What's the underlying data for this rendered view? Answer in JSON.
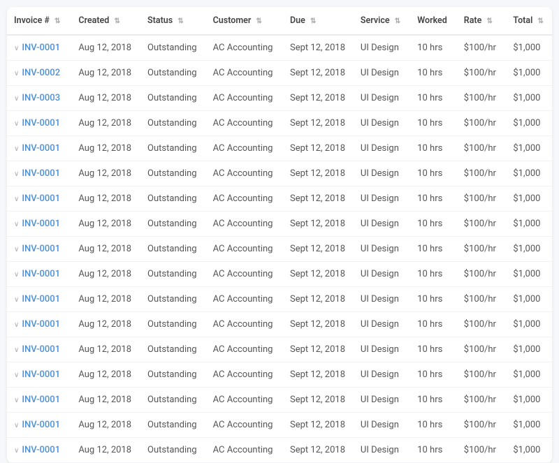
{
  "table": {
    "columns": [
      {
        "key": "invoice",
        "label": "Invoice #",
        "sortable": true
      },
      {
        "key": "created",
        "label": "Created",
        "sortable": true
      },
      {
        "key": "status",
        "label": "Status",
        "sortable": true
      },
      {
        "key": "customer",
        "label": "Customer",
        "sortable": true
      },
      {
        "key": "due",
        "label": "Due",
        "sortable": true
      },
      {
        "key": "service",
        "label": "Service",
        "sortable": true
      },
      {
        "key": "worked",
        "label": "Worked",
        "sortable": false
      },
      {
        "key": "rate",
        "label": "Rate",
        "sortable": true
      },
      {
        "key": "total",
        "label": "Total",
        "sortable": true
      }
    ],
    "rows": [
      {
        "invoice": "INV-0001",
        "created": "Aug 12, 2018",
        "status": "Outstanding",
        "customer": "AC Accounting",
        "due": "Sept 12, 2018",
        "service": "UI Design",
        "worked": "10 hrs",
        "rate": "$100/hr",
        "total": "$1,000"
      },
      {
        "invoice": "INV-0002",
        "created": "Aug 12, 2018",
        "status": "Outstanding",
        "customer": "AC Accounting",
        "due": "Sept 12, 2018",
        "service": "UI Design",
        "worked": "10 hrs",
        "rate": "$100/hr",
        "total": "$1,000"
      },
      {
        "invoice": "INV-0003",
        "created": "Aug 12, 2018",
        "status": "Outstanding",
        "customer": "AC Accounting",
        "due": "Sept 12, 2018",
        "service": "UI Design",
        "worked": "10 hrs",
        "rate": "$100/hr",
        "total": "$1,000"
      },
      {
        "invoice": "INV-0001",
        "created": "Aug 12, 2018",
        "status": "Outstanding",
        "customer": "AC Accounting",
        "due": "Sept 12, 2018",
        "service": "UI Design",
        "worked": "10 hrs",
        "rate": "$100/hr",
        "total": "$1,000"
      },
      {
        "invoice": "INV-0001",
        "created": "Aug 12, 2018",
        "status": "Outstanding",
        "customer": "AC Accounting",
        "due": "Sept 12, 2018",
        "service": "UI Design",
        "worked": "10 hrs",
        "rate": "$100/hr",
        "total": "$1,000"
      },
      {
        "invoice": "INV-0001",
        "created": "Aug 12, 2018",
        "status": "Outstanding",
        "customer": "AC Accounting",
        "due": "Sept 12, 2018",
        "service": "UI Design",
        "worked": "10 hrs",
        "rate": "$100/hr",
        "total": "$1,000"
      },
      {
        "invoice": "INV-0001",
        "created": "Aug 12, 2018",
        "status": "Outstanding",
        "customer": "AC Accounting",
        "due": "Sept 12, 2018",
        "service": "UI Design",
        "worked": "10 hrs",
        "rate": "$100/hr",
        "total": "$1,000"
      },
      {
        "invoice": "INV-0001",
        "created": "Aug 12, 2018",
        "status": "Outstanding",
        "customer": "AC Accounting",
        "due": "Sept 12, 2018",
        "service": "UI Design",
        "worked": "10 hrs",
        "rate": "$100/hr",
        "total": "$1,000"
      },
      {
        "invoice": "INV-0001",
        "created": "Aug 12, 2018",
        "status": "Outstanding",
        "customer": "AC Accounting",
        "due": "Sept 12, 2018",
        "service": "UI Design",
        "worked": "10 hrs",
        "rate": "$100/hr",
        "total": "$1,000"
      },
      {
        "invoice": "INV-0001",
        "created": "Aug 12, 2018",
        "status": "Outstanding",
        "customer": "AC Accounting",
        "due": "Sept 12, 2018",
        "service": "UI Design",
        "worked": "10 hrs",
        "rate": "$100/hr",
        "total": "$1,000"
      },
      {
        "invoice": "INV-0001",
        "created": "Aug 12, 2018",
        "status": "Outstanding",
        "customer": "AC Accounting",
        "due": "Sept 12, 2018",
        "service": "UI Design",
        "worked": "10 hrs",
        "rate": "$100/hr",
        "total": "$1,000"
      },
      {
        "invoice": "INV-0001",
        "created": "Aug 12, 2018",
        "status": "Outstanding",
        "customer": "AC Accounting",
        "due": "Sept 12, 2018",
        "service": "UI Design",
        "worked": "10 hrs",
        "rate": "$100/hr",
        "total": "$1,000"
      },
      {
        "invoice": "INV-0001",
        "created": "Aug 12, 2018",
        "status": "Outstanding",
        "customer": "AC Accounting",
        "due": "Sept 12, 2018",
        "service": "UI Design",
        "worked": "10 hrs",
        "rate": "$100/hr",
        "total": "$1,000"
      },
      {
        "invoice": "INV-0001",
        "created": "Aug 12, 2018",
        "status": "Outstanding",
        "customer": "AC Accounting",
        "due": "Sept 12, 2018",
        "service": "UI Design",
        "worked": "10 hrs",
        "rate": "$100/hr",
        "total": "$1,000"
      },
      {
        "invoice": "INV-0001",
        "created": "Aug 12, 2018",
        "status": "Outstanding",
        "customer": "AC Accounting",
        "due": "Sept 12, 2018",
        "service": "UI Design",
        "worked": "10 hrs",
        "rate": "$100/hr",
        "total": "$1,000"
      },
      {
        "invoice": "INV-0001",
        "created": "Aug 12, 2018",
        "status": "Outstanding",
        "customer": "AC Accounting",
        "due": "Sept 12, 2018",
        "service": "UI Design",
        "worked": "10 hrs",
        "rate": "$100/hr",
        "total": "$1,000"
      },
      {
        "invoice": "INV-0001",
        "created": "Aug 12, 2018",
        "status": "Outstanding",
        "customer": "AC Accounting",
        "due": "Sept 12, 2018",
        "service": "UI Design",
        "worked": "10 hrs",
        "rate": "$100/hr",
        "total": "$1,000"
      }
    ]
  }
}
